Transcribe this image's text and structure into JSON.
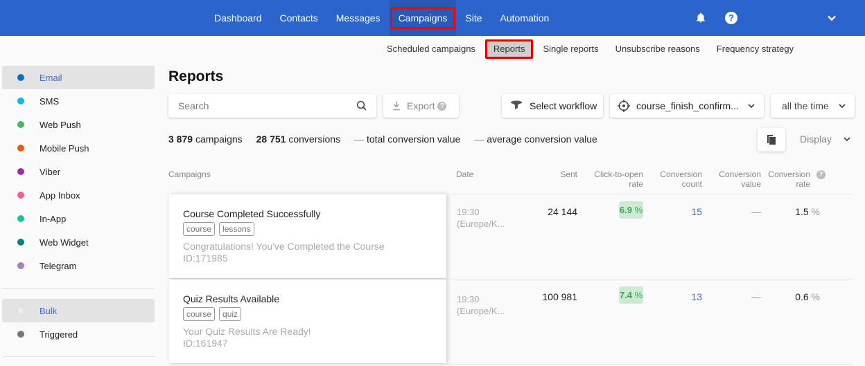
{
  "topbar": {
    "nav": [
      "Dashboard",
      "Contacts",
      "Messages",
      "Campaigns",
      "Site",
      "Automation"
    ],
    "active": "Campaigns",
    "icons": [
      "bell-icon",
      "help-icon",
      "chevron-down-icon"
    ],
    "help_glyph": "?"
  },
  "subnav": {
    "items": [
      "Scheduled campaigns",
      "Reports",
      "Single reports",
      "Unsubscribe reasons",
      "Frequency strategy"
    ],
    "active": "Reports"
  },
  "sidebar": {
    "channels": [
      {
        "label": "Email",
        "color": "#0a6fbf",
        "selected": true
      },
      {
        "label": "SMS",
        "color": "#12b5f3"
      },
      {
        "label": "Web Push",
        "color": "#52b06a"
      },
      {
        "label": "Mobile Push",
        "color": "#f15a12"
      },
      {
        "label": "Viber",
        "color": "#9d2aa6"
      },
      {
        "label": "App Inbox",
        "color": "#f55f92"
      },
      {
        "label": "In-App",
        "color": "#1fc29c"
      },
      {
        "label": "Web Widget",
        "color": "#0a7f7b"
      },
      {
        "label": "Telegram",
        "color": "#a284bd"
      }
    ],
    "types": [
      {
        "label": "Bulk",
        "selected": true
      },
      {
        "label": "Triggered",
        "color": "#777777"
      }
    ]
  },
  "main": {
    "title": "Reports",
    "search_placeholder": "Search",
    "export_label": "Export",
    "export_help": "?",
    "workflow_label": "Select workflow",
    "segment_value": "course_finish_confirm...",
    "period_value": "all the time",
    "stats": {
      "campaigns_count": "3 879",
      "campaigns_label": "campaigns",
      "conversions_count": "28 751",
      "conversions_label": "conversions",
      "total_value": "—",
      "total_value_label": "total conversion value",
      "avg_value": "—",
      "avg_value_label": "average conversion value"
    },
    "display_label": "Display"
  },
  "table": {
    "headers": {
      "campaigns": "Campaigns",
      "date": "Date",
      "sent": "Sent",
      "ctor_1": "Click-to-open",
      "ctor_2": "rate",
      "ccount_1": "Conversion",
      "ccount_2": "count",
      "cvalue_1": "Conversion",
      "cvalue_2": "value",
      "crate_1": "Conversion",
      "crate_2": "rate",
      "crate_help": "?"
    },
    "rows": [
      {
        "title": "Course Completed Successfully",
        "tags": [
          "course",
          "lessons"
        ],
        "subject": "Congratulations! You've Completed the Course",
        "id": "ID:171985",
        "time": "19:30",
        "tz": "(Europe/K...",
        "sent": "24 144",
        "ctor": "6.9",
        "ccount": "15",
        "cvalue": "—",
        "crate": "1.5"
      },
      {
        "title": "Quiz Results Available",
        "tags": [
          "course",
          "quiz"
        ],
        "subject": "Your Quiz Results Are Ready!",
        "id": "ID:161947",
        "time": "19:30",
        "tz": "(Europe/K...",
        "sent": "100 981",
        "ctor": "7.4",
        "ccount": "13",
        "cvalue": "—",
        "crate": "0.6"
      }
    ],
    "pct": "%"
  }
}
